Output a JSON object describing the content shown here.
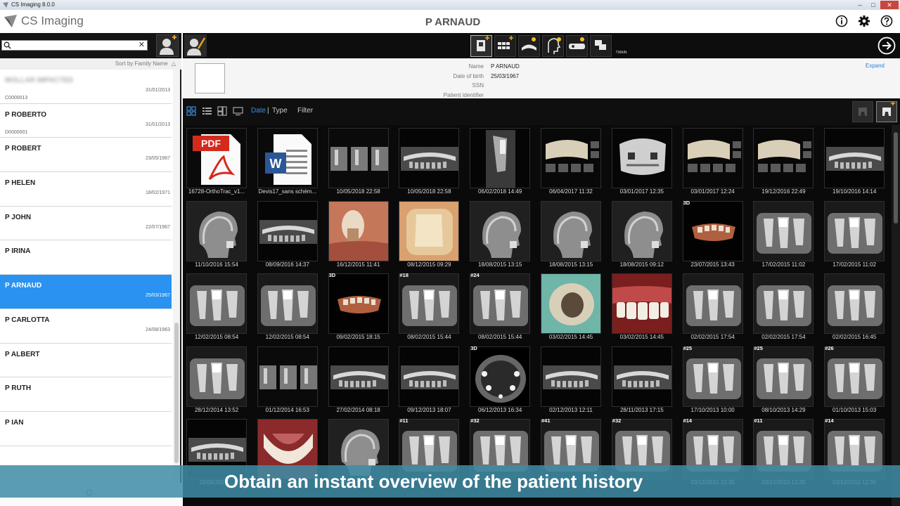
{
  "window": {
    "title": "CS Imaging 8.0.0"
  },
  "app": {
    "brand": "CS Imaging"
  },
  "header": {
    "patient_name": "P ARNAUD"
  },
  "sidebar": {
    "sort_label": "Sort by Family Name",
    "patients": [
      {
        "name": "MOLLAR IMPACTED",
        "date": "31/01/2013",
        "id": "C0000013",
        "blurred": true
      },
      {
        "name": "P ROBERTO",
        "date": "31/01/2013",
        "id": "D0000001"
      },
      {
        "name": "P ROBERT",
        "date": "23/05/1967"
      },
      {
        "name": "P HELEN",
        "date": "18/02/1971"
      },
      {
        "name": "P JOHN",
        "date": "22/07/1967"
      },
      {
        "name": "P IRINA",
        "date": ""
      },
      {
        "name": "P ARNAUD",
        "date": "25/03/1967",
        "selected": true
      },
      {
        "name": "P CARLOTTA",
        "date": "24/08/1963"
      },
      {
        "name": "P ALBERT",
        "date": ""
      },
      {
        "name": "P RUTH",
        "date": ""
      },
      {
        "name": "P IAN",
        "date": ""
      }
    ]
  },
  "toolbar": {
    "twain_label": "TWAIN"
  },
  "patient_info": {
    "labels": {
      "name": "Name",
      "dob": "Date of birth",
      "ssn": "SSN",
      "pid": "Patient identifier"
    },
    "name": "P ARNAUD",
    "dob": "25/03/1967",
    "ssn": "",
    "pid": "",
    "expand_label": "Expand"
  },
  "view_bar": {
    "date": "Date",
    "separator": "|",
    "type": "Type",
    "filter": "Filter"
  },
  "thumbnails": [
    {
      "caption": "16728-OrthoTrac_v1...",
      "kind": "pdf",
      "tag": ""
    },
    {
      "caption": "Devis17_sans schém...",
      "kind": "word",
      "tag": ""
    },
    {
      "caption": "10/05/2018 22:58",
      "kind": "triple",
      "tag": ""
    },
    {
      "caption": "10/05/2018 22:58",
      "kind": "pano",
      "tag": ""
    },
    {
      "caption": "06/02/2018 14:49",
      "kind": "ct",
      "tag": ""
    },
    {
      "caption": "06/04/2017 11:32",
      "kind": "multi3d",
      "tag": ""
    },
    {
      "caption": "03/01/2017 12:35",
      "kind": "skull3d",
      "tag": ""
    },
    {
      "caption": "03/01/2017 12:24",
      "kind": "multi3d",
      "tag": ""
    },
    {
      "caption": "19/12/2016 22:49",
      "kind": "multi3d",
      "tag": ""
    },
    {
      "caption": "19/10/2016 14:14",
      "kind": "pano",
      "tag": ""
    },
    {
      "caption": "11/10/2016 15:54",
      "kind": "ceph",
      "tag": ""
    },
    {
      "caption": "08/09/2016 14:37",
      "kind": "pano",
      "tag": ""
    },
    {
      "caption": "16/12/2015 11:41",
      "kind": "photo-gum",
      "tag": ""
    },
    {
      "caption": "08/12/2015 09:29",
      "kind": "photo-tooth",
      "tag": ""
    },
    {
      "caption": "18/08/2015 13:15",
      "kind": "ceph",
      "tag": ""
    },
    {
      "caption": "18/08/2015 13:15",
      "kind": "ceph",
      "tag": ""
    },
    {
      "caption": "18/08/2015 09:12",
      "kind": "ceph",
      "tag": ""
    },
    {
      "caption": "23/07/2015 13:43",
      "kind": "model3d",
      "tag": "3D"
    },
    {
      "caption": "17/02/2015 11:02",
      "kind": "xray",
      "tag": ""
    },
    {
      "caption": "17/02/2015 11:02",
      "kind": "xray",
      "tag": ""
    },
    {
      "caption": "12/02/2015 08:54",
      "kind": "xray",
      "tag": ""
    },
    {
      "caption": "12/02/2015 08:54",
      "kind": "xray",
      "tag": ""
    },
    {
      "caption": "09/02/2015 18:15",
      "kind": "model3d",
      "tag": "3D"
    },
    {
      "caption": "08/02/2015 15:44",
      "kind": "xray",
      "tag": "#18"
    },
    {
      "caption": "08/02/2015 15:44",
      "kind": "xray",
      "tag": "#24"
    },
    {
      "caption": "03/02/2015 14:45",
      "kind": "photo-cavity",
      "tag": ""
    },
    {
      "caption": "03/02/2015 14:45",
      "kind": "photo-teeth",
      "tag": ""
    },
    {
      "caption": "02/02/2015 17:54",
      "kind": "xray",
      "tag": ""
    },
    {
      "caption": "02/02/2015 17:54",
      "kind": "xray",
      "tag": ""
    },
    {
      "caption": "02/02/2015 16:45",
      "kind": "xray",
      "tag": ""
    },
    {
      "caption": "28/12/2014 13:52",
      "kind": "xray",
      "tag": ""
    },
    {
      "caption": "01/12/2014 16:53",
      "kind": "triple",
      "tag": ""
    },
    {
      "caption": "27/02/2014 08:18",
      "kind": "pano",
      "tag": ""
    },
    {
      "caption": "09/12/2013 18:07",
      "kind": "pano",
      "tag": ""
    },
    {
      "caption": "06/12/2013 16:34",
      "kind": "ctslice",
      "tag": "3D"
    },
    {
      "caption": "02/12/2013 12:11",
      "kind": "pano",
      "tag": ""
    },
    {
      "caption": "28/11/2013 17:15",
      "kind": "pano",
      "tag": ""
    },
    {
      "caption": "17/10/2013 10:00",
      "kind": "xray",
      "tag": "#25"
    },
    {
      "caption": "08/10/2013 14:29",
      "kind": "xray",
      "tag": "#25"
    },
    {
      "caption": "01/10/2013 15:03",
      "kind": "xray",
      "tag": "#26"
    },
    {
      "caption": "22/05/2013 ...",
      "kind": "pano",
      "tag": ""
    },
    {
      "caption": "",
      "kind": "photo-arch",
      "tag": ""
    },
    {
      "caption": "",
      "kind": "ceph",
      "tag": ""
    },
    {
      "caption": "",
      "kind": "xray",
      "tag": "#11"
    },
    {
      "caption": "",
      "kind": "xray",
      "tag": "#32"
    },
    {
      "caption": "",
      "kind": "xray",
      "tag": "#41"
    },
    {
      "caption": "",
      "kind": "xray",
      "tag": "#32"
    },
    {
      "caption": "03/12/2010 12:35",
      "kind": "xray",
      "tag": "#14"
    },
    {
      "caption": "03/12/2010 12:35",
      "kind": "xray",
      "tag": "#11"
    },
    {
      "caption": "03/12/2010 12:35",
      "kind": "xray",
      "tag": "#14"
    }
  ],
  "banner": {
    "text": "Obtain an instant overview of the patient history"
  },
  "colors": {
    "accent": "#2a92f1",
    "banner": "#3f8ca5",
    "link": "#3f8ee0"
  }
}
